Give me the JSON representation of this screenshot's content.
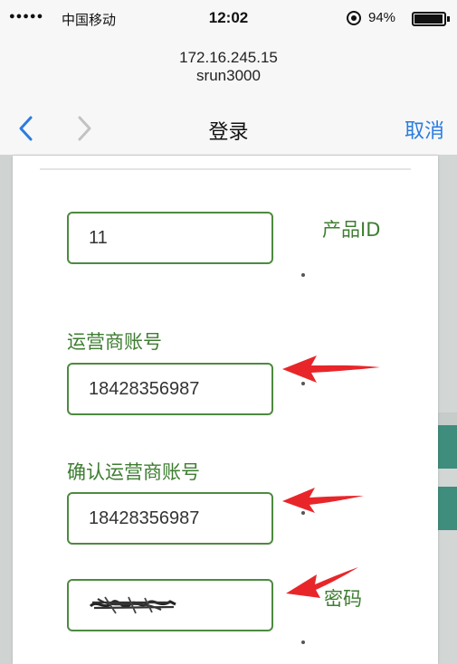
{
  "status_bar": {
    "signal": "●●●●●",
    "carrier": "中国移动",
    "time": "12:02",
    "battery_percent": "94%"
  },
  "browser": {
    "host_ip": "172.16.245.15",
    "host_name": "srun3000"
  },
  "nav": {
    "title": "登录",
    "cancel_label": "取消",
    "accent_color": "#2a7ce0"
  },
  "form": {
    "product_id": {
      "label": "产品ID",
      "value": "11"
    },
    "carrier_account": {
      "label": "运营商账号",
      "value": "18428356987"
    },
    "confirm_carrier_account": {
      "label": "确认运营商账号",
      "value": "18428356987"
    },
    "password": {
      "label": "密码"
    },
    "field_border_color": "#4d8a3f",
    "label_color": "#3e7d32"
  },
  "annotations": {
    "arrow_color": "#e8262a"
  }
}
